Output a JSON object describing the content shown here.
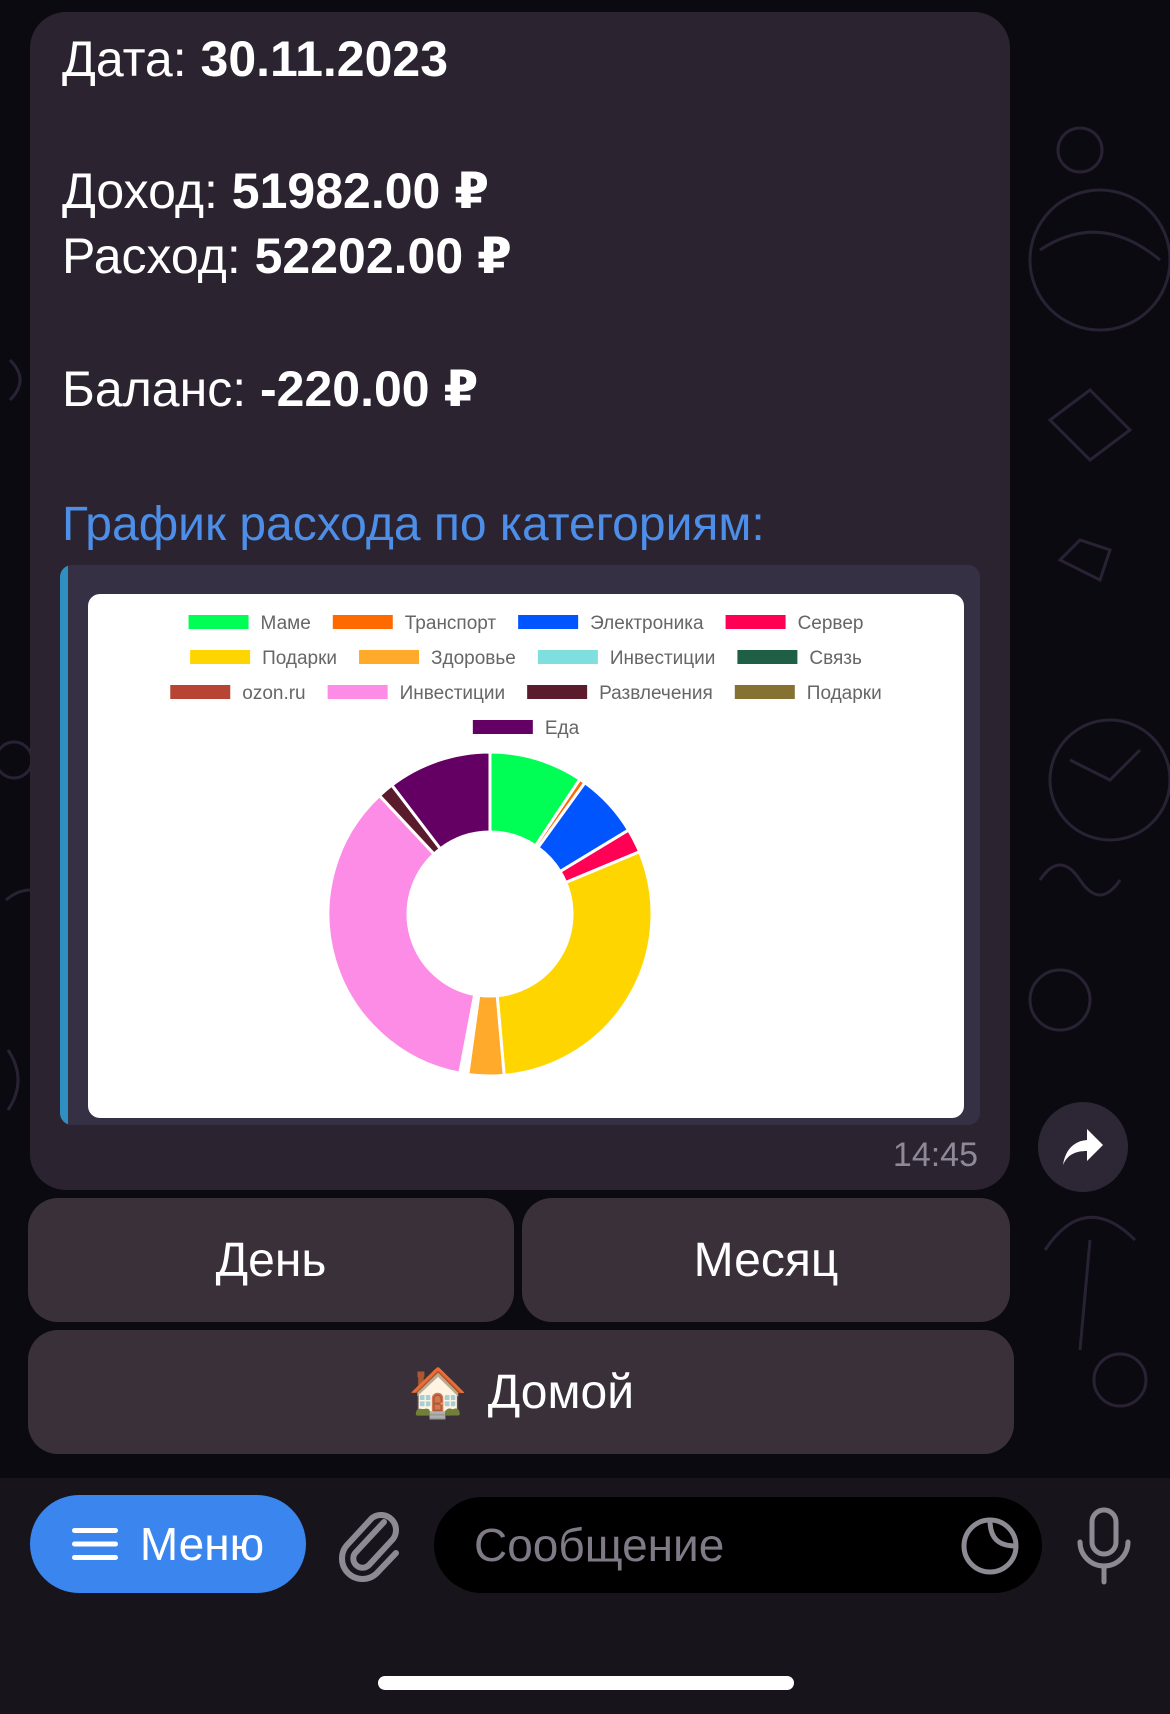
{
  "message": {
    "date_label": "Дата:",
    "date_value": "30.11.2023",
    "income_label": "Доход:",
    "income_value": "51982.00 ₽",
    "expense_label": "Расход:",
    "expense_value": "52202.00 ₽",
    "balance_label": "Баланс:",
    "balance_value": "-220.00 ₽",
    "chart_heading": "График расхода по категориям:",
    "time": "14:45"
  },
  "chart_data": {
    "type": "pie",
    "title": "",
    "legend_position": "top",
    "categories": [
      "Маме",
      "Транспорт",
      "Электроника",
      "Сервер",
      "Подарки",
      "Здоровье",
      "Инвестиции",
      "Связь",
      "ozon.ru",
      "Инвестиции",
      "Развлечения",
      "Подарки",
      "Еда"
    ],
    "colors": [
      "#00ff55",
      "#ff6a00",
      "#0055ff",
      "#ff0055",
      "#ffd500",
      "#ffaa2a",
      "#7fdfdf",
      "#1e5f46",
      "#b84534",
      "#fc8ce6",
      "#5a1c2c",
      "#857233",
      "#640064"
    ],
    "values": [
      4700,
      300,
      3200,
      1200,
      15000,
      1800,
      150,
      150,
      100,
      17600,
      800,
      0,
      5200
    ],
    "unit": "₽"
  },
  "keyboard": {
    "day_label": "День",
    "month_label": "Месяц",
    "home_emoji": "🏠",
    "home_label": "Домой"
  },
  "input_bar": {
    "menu_label": "Меню",
    "placeholder": "Сообщение"
  },
  "icons": [
    "share-icon",
    "hamburger-icon",
    "paperclip-icon",
    "sticker-icon",
    "microphone-icon",
    "house-emoji"
  ]
}
